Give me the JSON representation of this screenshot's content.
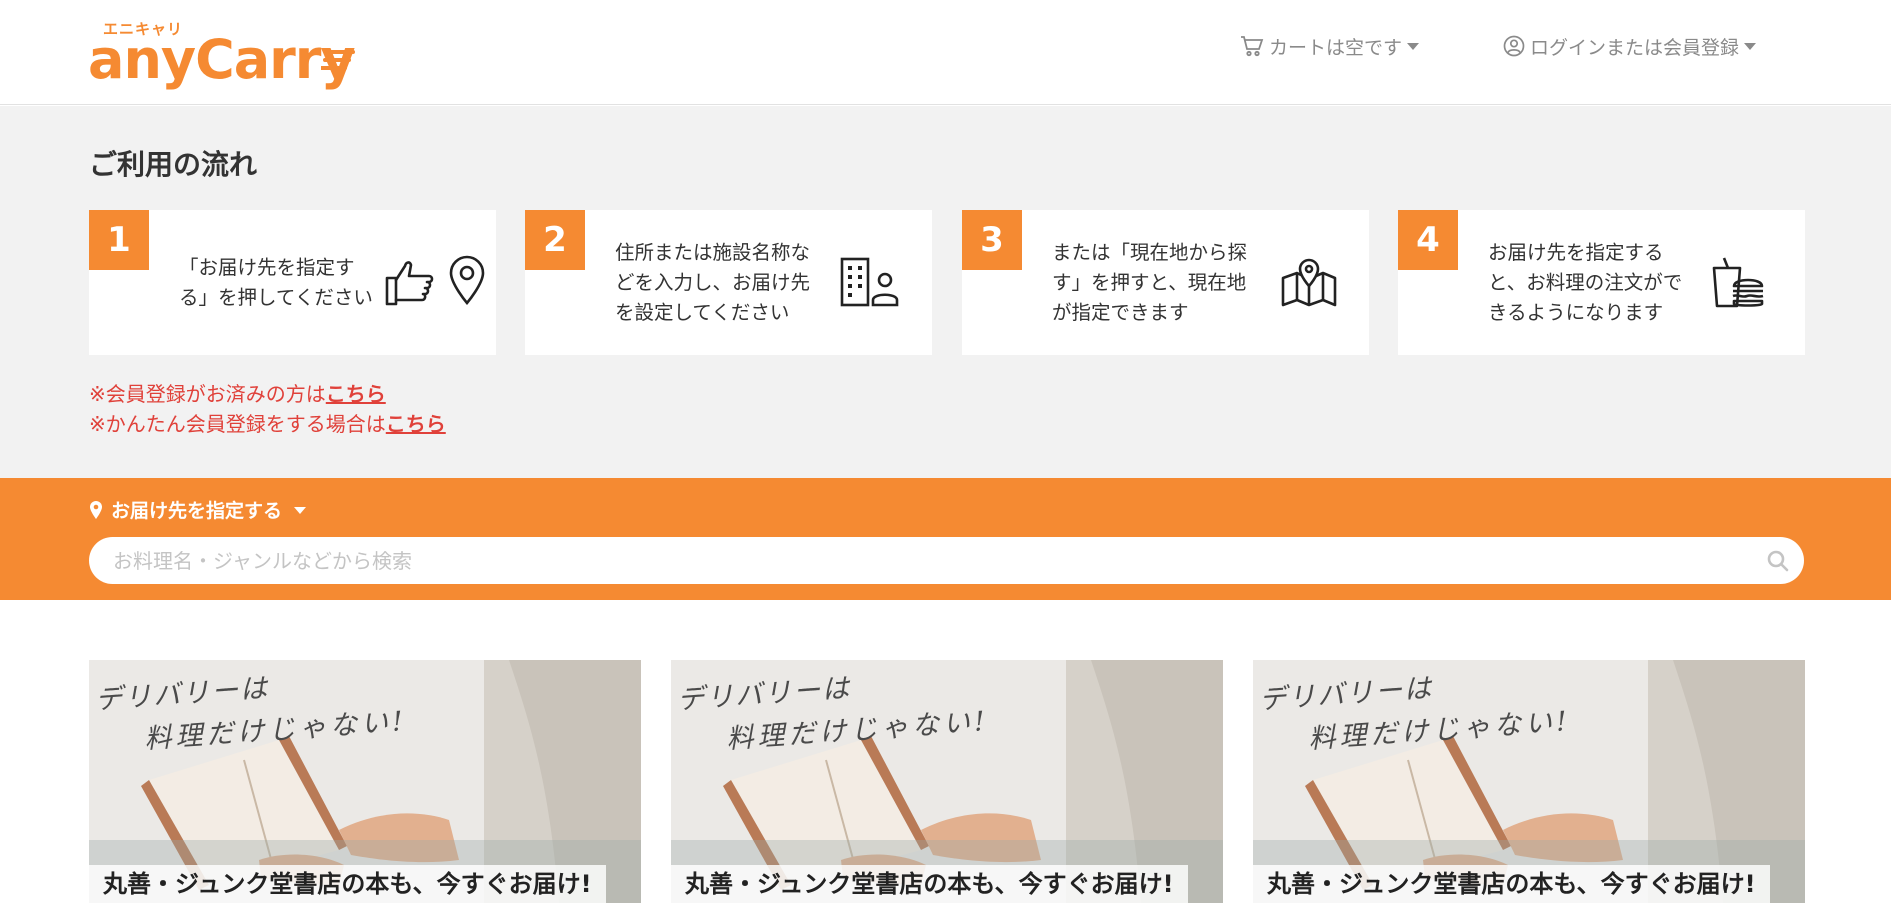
{
  "header": {
    "logo_kana": "エニキャリ",
    "logo_text": "anyCarry",
    "cart_label": "カートは空です",
    "login_label": "ログインまたは会員登録"
  },
  "flow": {
    "title": "ご利用の流れ",
    "steps": [
      {
        "number": "1",
        "text": "「お届け先を指定する」を押してください",
        "icons": [
          "pointing-hand-icon",
          "map-pin-icon"
        ]
      },
      {
        "number": "2",
        "text": "住所または施設名称などを入力し、お届け先を設定してください",
        "icons": [
          "building-person-icon"
        ]
      },
      {
        "number": "3",
        "text": "または「現在地から探す」を押すと、現在地が指定できます",
        "icons": [
          "map-icon"
        ]
      },
      {
        "number": "4",
        "text": "お届け先を指定すると、お料理の注文ができるようになります",
        "icons": [
          "takeout-food-icon"
        ]
      }
    ],
    "notes": [
      {
        "text": "※会員登録がお済みの方は",
        "link": "こちら"
      },
      {
        "text": "※かんたん会員登録をする場合は",
        "link": "こちら"
      }
    ]
  },
  "search": {
    "delivery_label": "お届け先を指定する",
    "placeholder": "お料理名・ジャンルなどから検索"
  },
  "banners": [
    {
      "handwriting_line1": "デリバリーは",
      "handwriting_line2": "料理だけじゃない!",
      "caption": "丸善・ジュンク堂書店の本も、今すぐお届け!"
    },
    {
      "handwriting_line1": "デリバリーは",
      "handwriting_line2": "料理だけじゃない!",
      "caption": "丸善・ジュンク堂書店の本も、今すぐお届け!"
    },
    {
      "handwriting_line1": "デリバリーは",
      "handwriting_line2": "料理だけじゃない!",
      "caption": "丸善・ジュンク堂書店の本も、今すぐお届け!"
    }
  ],
  "colors": {
    "brand_orange": "#f58a32",
    "notice_red": "#e0413a",
    "flow_background": "#f2f2f2"
  }
}
